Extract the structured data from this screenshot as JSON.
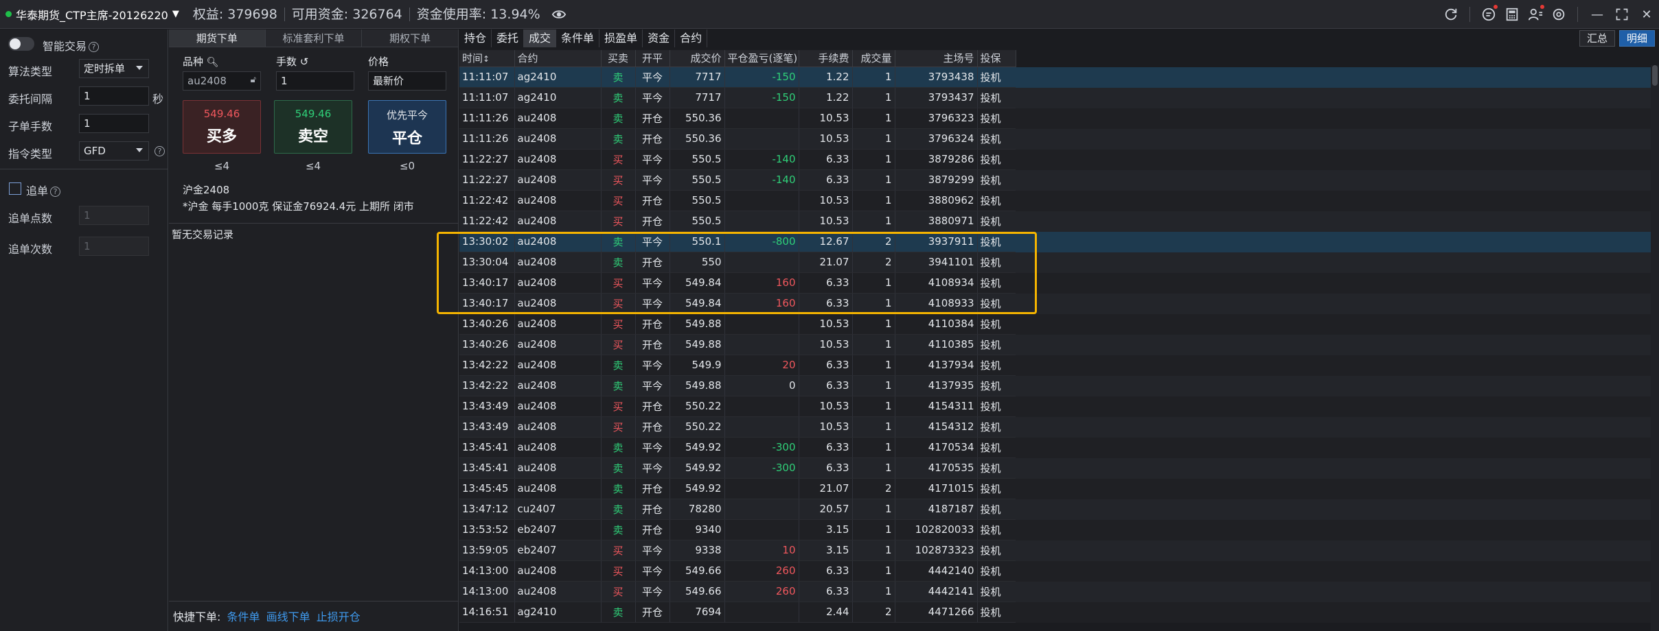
{
  "topbar": {
    "account": "华泰期货_CTP主席-20126220",
    "equity": "权益: 379698",
    "available": "可用资金: 326764",
    "usage": "资金使用率: 13.94%"
  },
  "left": {
    "smart_trade": "智能交易",
    "algo_label": "算法类型",
    "algo_value": "定时拆单",
    "interval_label": "委托间隔",
    "interval_value": "1",
    "interval_unit": "秒",
    "sub_qty_label": "子单手数",
    "sub_qty_value": "1",
    "order_type_label": "指令类型",
    "order_type_value": "GFD",
    "chase_label": "追单",
    "chase_points_label": "追单点数",
    "chase_points_value": "1",
    "chase_times_label": "追单次数",
    "chase_times_value": "1"
  },
  "order": {
    "tabs": [
      "期货下单",
      "标准套利下单",
      "期权下单"
    ],
    "product_label": "品种",
    "product_value": "au2408",
    "qty_label": "手数",
    "qty_value": "1",
    "price_label": "价格",
    "price_value": "最新价",
    "buy_price": "549.46",
    "buy_label": "买多",
    "sell_price": "549.46",
    "sell_label": "卖空",
    "close_top": "优先平今",
    "close_label": "平仓",
    "buy_limit": "≤4",
    "sell_limit": "≤4",
    "close_limit": "≤0",
    "contract_name": "沪金2408",
    "contract_info": "*沪金 每手1000克 保证金76924.4元 上期所 闭市",
    "no_records": "暂无交易记录",
    "quick_label": "快捷下单:",
    "quick_links": [
      "条件单",
      "画线下单",
      "止损开仓"
    ]
  },
  "trade": {
    "tabs": [
      "持仓",
      "委托",
      "成交",
      "条件单",
      "损盈单",
      "资金",
      "合约"
    ],
    "summary_btn": "汇总",
    "detail_btn": "明细",
    "columns": [
      "时间",
      "合约",
      "买卖",
      "开平",
      "成交价",
      "平仓盈亏(逐笔)",
      "手续费",
      "成交量",
      "主场号",
      "投保"
    ],
    "rows": [
      [
        "11:11:07",
        "ag2410",
        "卖",
        "平今",
        "7717",
        "-150",
        "1.22",
        "1",
        "3793438",
        "投机"
      ],
      [
        "11:11:07",
        "ag2410",
        "卖",
        "平今",
        "7717",
        "-150",
        "1.22",
        "1",
        "3793437",
        "投机"
      ],
      [
        "11:11:26",
        "au2408",
        "卖",
        "开仓",
        "550.36",
        "",
        "10.53",
        "1",
        "3796323",
        "投机"
      ],
      [
        "11:11:26",
        "au2408",
        "卖",
        "开仓",
        "550.36",
        "",
        "10.53",
        "1",
        "3796324",
        "投机"
      ],
      [
        "11:22:27",
        "au2408",
        "买",
        "平今",
        "550.5",
        "-140",
        "6.33",
        "1",
        "3879286",
        "投机"
      ],
      [
        "11:22:27",
        "au2408",
        "买",
        "平今",
        "550.5",
        "-140",
        "6.33",
        "1",
        "3879299",
        "投机"
      ],
      [
        "11:22:42",
        "au2408",
        "买",
        "开仓",
        "550.5",
        "",
        "10.53",
        "1",
        "3880962",
        "投机"
      ],
      [
        "11:22:42",
        "au2408",
        "买",
        "开仓",
        "550.5",
        "",
        "10.53",
        "1",
        "3880971",
        "投机"
      ],
      [
        "13:30:02",
        "au2408",
        "卖",
        "平今",
        "550.1",
        "-800",
        "12.67",
        "2",
        "3937911",
        "投机"
      ],
      [
        "13:30:04",
        "au2408",
        "卖",
        "开仓",
        "550",
        "",
        "21.07",
        "2",
        "3941101",
        "投机"
      ],
      [
        "13:40:17",
        "au2408",
        "买",
        "平今",
        "549.84",
        "160",
        "6.33",
        "1",
        "4108934",
        "投机"
      ],
      [
        "13:40:17",
        "au2408",
        "买",
        "平今",
        "549.84",
        "160",
        "6.33",
        "1",
        "4108933",
        "投机"
      ],
      [
        "13:40:26",
        "au2408",
        "买",
        "开仓",
        "549.88",
        "",
        "10.53",
        "1",
        "4110384",
        "投机"
      ],
      [
        "13:40:26",
        "au2408",
        "买",
        "开仓",
        "549.88",
        "",
        "10.53",
        "1",
        "4110385",
        "投机"
      ],
      [
        "13:42:22",
        "au2408",
        "卖",
        "平今",
        "549.9",
        "20",
        "6.33",
        "1",
        "4137934",
        "投机"
      ],
      [
        "13:42:22",
        "au2408",
        "卖",
        "平今",
        "549.88",
        "0",
        "6.33",
        "1",
        "4137935",
        "投机"
      ],
      [
        "13:43:49",
        "au2408",
        "买",
        "开仓",
        "550.22",
        "",
        "10.53",
        "1",
        "4154311",
        "投机"
      ],
      [
        "13:43:49",
        "au2408",
        "买",
        "开仓",
        "550.22",
        "",
        "10.53",
        "1",
        "4154312",
        "投机"
      ],
      [
        "13:45:41",
        "au2408",
        "卖",
        "平今",
        "549.92",
        "-300",
        "6.33",
        "1",
        "4170534",
        "投机"
      ],
      [
        "13:45:41",
        "au2408",
        "卖",
        "平今",
        "549.92",
        "-300",
        "6.33",
        "1",
        "4170535",
        "投机"
      ],
      [
        "13:45:45",
        "au2408",
        "卖",
        "开仓",
        "549.92",
        "",
        "21.07",
        "2",
        "4171015",
        "投机"
      ],
      [
        "13:47:12",
        "cu2407",
        "卖",
        "开仓",
        "78280",
        "",
        "20.57",
        "1",
        "4187187",
        "投机"
      ],
      [
        "13:53:52",
        "eb2407",
        "卖",
        "开仓",
        "9340",
        "",
        "3.15",
        "1",
        "102820033",
        "投机"
      ],
      [
        "13:59:05",
        "eb2407",
        "买",
        "平今",
        "9338",
        "10",
        "3.15",
        "1",
        "102873323",
        "投机"
      ],
      [
        "14:13:00",
        "au2408",
        "买",
        "平今",
        "549.66",
        "260",
        "6.33",
        "1",
        "4442140",
        "投机"
      ],
      [
        "14:13:00",
        "au2408",
        "买",
        "平今",
        "549.66",
        "260",
        "6.33",
        "1",
        "4442141",
        "投机"
      ],
      [
        "14:16:51",
        "ag2410",
        "卖",
        "开仓",
        "7694",
        "",
        "2.44",
        "2",
        "4471266",
        "投机"
      ]
    ],
    "colors": {
      "buy": "#f0575d",
      "sell": "#2fcf78",
      "accent": "#1f5fa8",
      "highlight_box": "#f5b400"
    }
  }
}
